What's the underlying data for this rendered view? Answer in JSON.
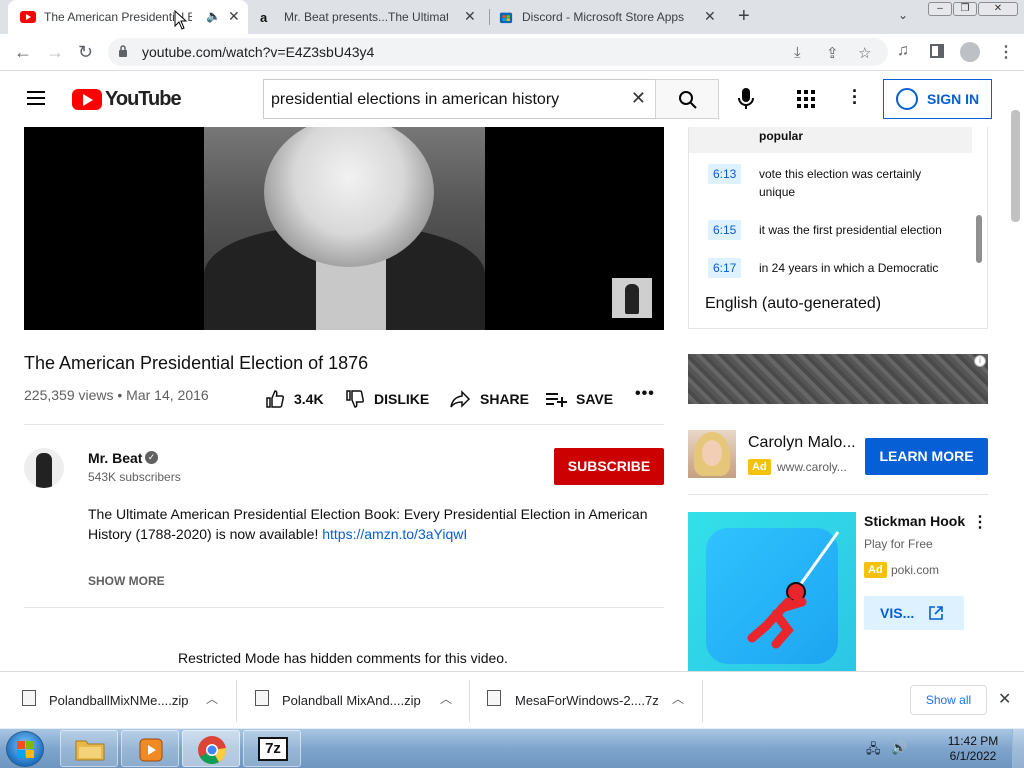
{
  "browser": {
    "tabs": [
      {
        "title": "The American Presidential E",
        "active": true
      },
      {
        "title": "Mr. Beat presents...The Ultimate",
        "active": false
      },
      {
        "title": "Discord - Microsoft Store Apps",
        "active": false
      }
    ],
    "url": "youtube.com/watch?v=E4Z3sbU43y4"
  },
  "youtube": {
    "logo_text": "YouTube",
    "search_query": "presidential elections in american history",
    "sign_in": "SIGN IN"
  },
  "video": {
    "title": "The American Presidential Election of 1876",
    "meta": "225,359 views • Mar 14, 2016",
    "likes": "3.4K",
    "dislike": "DISLIKE",
    "share": "SHARE",
    "save": "SAVE"
  },
  "channel": {
    "name": "Mr. Beat",
    "subscribers": "543K subscribers",
    "subscribe": "SUBSCRIBE"
  },
  "description": {
    "text": "The Ultimate American Presidential Election Book: Every Presidential Election in American History (1788-2020) is now available! ",
    "link": "https://amzn.to/3aYiqwI",
    "show_more": "SHOW MORE"
  },
  "comments_notice": "Restricted Mode has hidden comments for this video.",
  "transcript": {
    "active_text": "popular",
    "rows": [
      {
        "time": "6:13",
        "text": "vote this election was certainly unique"
      },
      {
        "time": "6:15",
        "text": "it was the first presidential election"
      },
      {
        "time": "6:17",
        "text": "in 24 years in which a Democratic"
      }
    ],
    "language": "English (auto-generated)"
  },
  "ads": {
    "ad1": {
      "name": "Carolyn Malo...",
      "badge": "Ad",
      "url": "www.caroly...",
      "cta": "LEARN MORE"
    },
    "ad2": {
      "title": "Stickman Hook",
      "subtitle": "Play for Free",
      "badge": "Ad",
      "url": "poki.com",
      "cta": "VIS..."
    }
  },
  "downloads": {
    "items": [
      {
        "name": "PolandballMixNMe....zip"
      },
      {
        "name": "Polandball MixAnd....zip"
      },
      {
        "name": "MesaForWindows-2....7z"
      }
    ],
    "show_all": "Show all"
  },
  "taskbar": {
    "time": "11:42 PM",
    "date": "6/1/2022"
  },
  "colors": {
    "yt_red": "#ff0000",
    "subscribe_red": "#cc0000",
    "link_blue": "#065fd4",
    "ad_yellow": "#f4c20d"
  }
}
